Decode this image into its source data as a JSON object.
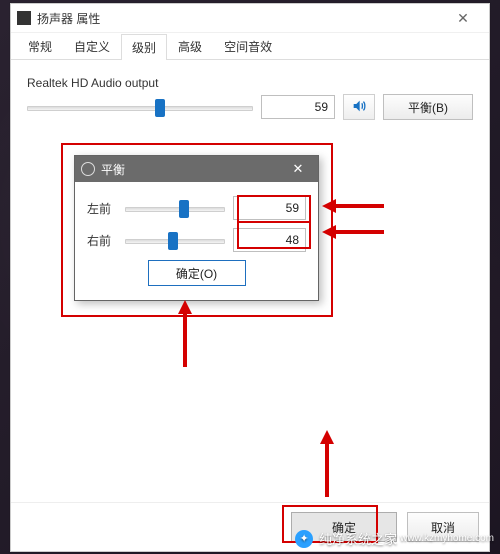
{
  "window": {
    "title": "扬声器 属性",
    "close_glyph": "✕"
  },
  "tabs": [
    {
      "label": "常规"
    },
    {
      "label": "自定义"
    },
    {
      "label": "级别",
      "active": true
    },
    {
      "label": "高级"
    },
    {
      "label": "空间音效"
    }
  ],
  "level": {
    "output_label": "Realtek HD Audio output",
    "value": "59",
    "slider_percent": 59,
    "volume_icon": "volume-icon",
    "balance_button": "平衡(B)"
  },
  "balance_popup": {
    "title": "平衡",
    "close_glyph": "✕",
    "channels": [
      {
        "label": "左前",
        "value": "59",
        "percent": 59
      },
      {
        "label": "右前",
        "value": "48",
        "percent": 48
      }
    ],
    "ok_label": "确定(O)"
  },
  "footer": {
    "ok": "确定",
    "cancel": "取消"
  },
  "watermark": {
    "text": "纯净系统之家",
    "url": "www.kzmyhome.com"
  }
}
